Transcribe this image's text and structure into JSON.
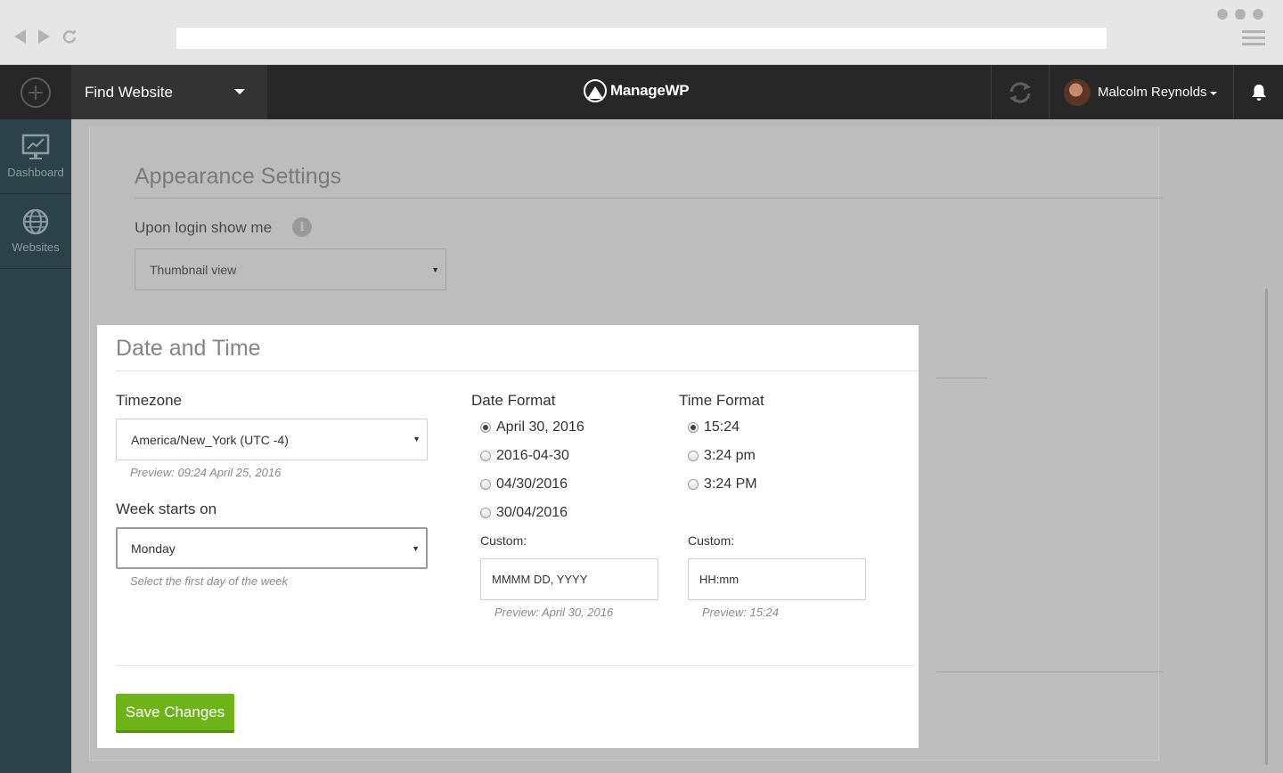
{
  "nav": {
    "find_website": "Find Website",
    "logo": "ManageWP",
    "user_name": "Malcolm Reynolds"
  },
  "sidebar": {
    "items": [
      {
        "label": "Dashboard",
        "icon": "dashboard-icon"
      },
      {
        "label": "Websites",
        "icon": "globe-icon"
      }
    ]
  },
  "appearance": {
    "title": "Appearance Settings",
    "login_label": "Upon login show me",
    "login_value": "Thumbnail view"
  },
  "date_time": {
    "title": "Date and Time",
    "timezone_label": "Timezone",
    "timezone_value": "America/New_York (UTC -4)",
    "timezone_preview": "Preview: 09:24 April 25, 2016",
    "week_label": "Week starts on",
    "week_value": "Monday",
    "week_hint": "Select the first day of the week",
    "date_format_label": "Date Format",
    "date_options": [
      "April 30, 2016",
      "2016-04-30",
      "04/30/2016",
      "30/04/2016"
    ],
    "date_selected_index": 0,
    "date_custom_label": "Custom:",
    "date_custom_value": "MMMM DD, YYYY",
    "date_preview": "Preview: April 30, 2016",
    "time_format_label": "Time Format",
    "time_options": [
      "15:24",
      "3:24 pm",
      "3:24 PM"
    ],
    "time_selected_index": 0,
    "time_custom_label": "Custom:",
    "time_custom_value": "HH:mm",
    "time_preview": "Preview: 15:24",
    "save_label": "Save Changes"
  },
  "colors": {
    "topbar": "#272727",
    "sidebar": "#2b4248",
    "save_button": "#6cb418"
  }
}
